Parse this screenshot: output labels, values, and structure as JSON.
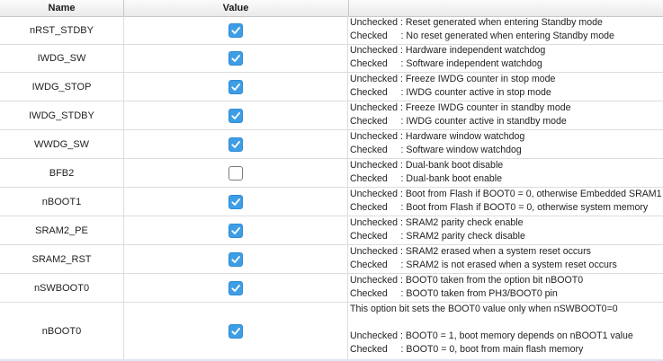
{
  "header": {
    "name": "Name",
    "value": "Value"
  },
  "rows": [
    {
      "name": "nRST_STDBY",
      "checked": true,
      "desc": [
        "Unchecked : Reset generated when entering Standby mode",
        "Checked     : No reset generated when entering Standby mode"
      ]
    },
    {
      "name": "IWDG_SW",
      "checked": true,
      "desc": [
        "Unchecked : Hardware independent watchdog",
        "Checked     : Software independent watchdog"
      ]
    },
    {
      "name": "IWDG_STOP",
      "checked": true,
      "desc": [
        "Unchecked : Freeze IWDG counter in stop mode",
        "Checked     : IWDG counter active in stop mode"
      ]
    },
    {
      "name": "IWDG_STDBY",
      "checked": true,
      "desc": [
        "Unchecked : Freeze IWDG counter in standby mode",
        "Checked     : IWDG counter active in standby mode"
      ]
    },
    {
      "name": "WWDG_SW",
      "checked": true,
      "desc": [
        "Unchecked : Hardware window watchdog",
        "Checked     : Software window watchdog"
      ]
    },
    {
      "name": "BFB2",
      "checked": false,
      "desc": [
        "Unchecked : Dual-bank boot disable",
        "Checked     : Dual-bank boot enable"
      ]
    },
    {
      "name": "nBOOT1",
      "checked": true,
      "desc": [
        "Unchecked : Boot from Flash if BOOT0 = 0, otherwise Embedded SRAM1",
        "Checked     : Boot from Flash if BOOT0 = 0, otherwise system memory"
      ]
    },
    {
      "name": "SRAM2_PE",
      "checked": true,
      "desc": [
        "Unchecked : SRAM2 parity check enable",
        "Checked     : SRAM2 parity check disable"
      ]
    },
    {
      "name": "SRAM2_RST",
      "checked": true,
      "desc": [
        "Unchecked : SRAM2 erased when a system reset occurs",
        "Checked     : SRAM2 is not erased when a system reset occurs"
      ]
    },
    {
      "name": "nSWBOOT0",
      "checked": true,
      "desc": [
        "Unchecked : BOOT0 taken from the option bit nBOOT0",
        "Checked     : BOOT0 taken from PH3/BOOT0 pin"
      ]
    },
    {
      "name": "nBOOT0",
      "checked": true,
      "desc": [
        "This option bit sets the BOOT0 value only when nSWBOOT0=0",
        "",
        "Unchecked : BOOT0 = 1, boot memory depends on nBOOT1 value",
        "Checked     : BOOT0 = 0, boot from main flash memory"
      ]
    }
  ],
  "colors": {
    "check_accent": "#3d9ee6",
    "grid": "#dcdcdc"
  }
}
